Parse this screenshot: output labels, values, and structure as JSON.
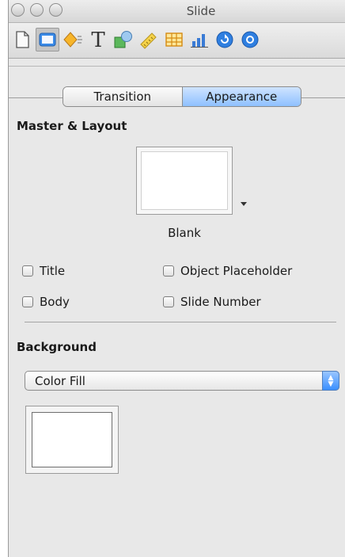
{
  "window": {
    "title": "Slide"
  },
  "toolbar": {
    "items": [
      {
        "name": "document-inspector",
        "icon": "document-icon"
      },
      {
        "name": "slide-inspector",
        "icon": "slide-icon",
        "selected": true
      },
      {
        "name": "slide-transition-inspector",
        "icon": "diamond-icon"
      },
      {
        "name": "text-inspector",
        "icon": "text-icon",
        "glyph": "T"
      },
      {
        "name": "graphic-inspector",
        "icon": "shapes-icon"
      },
      {
        "name": "metrics-inspector",
        "icon": "ruler-icon"
      },
      {
        "name": "table-inspector",
        "icon": "table-icon"
      },
      {
        "name": "chart-inspector",
        "icon": "chart-icon"
      },
      {
        "name": "hyperlink-inspector",
        "icon": "arrow-circle-icon"
      },
      {
        "name": "quicktime-inspector",
        "icon": "at-circle-icon"
      }
    ]
  },
  "tabs": {
    "transition": "Transition",
    "appearance": "Appearance",
    "active": "appearance"
  },
  "master_layout": {
    "heading": "Master & Layout",
    "thumbnail_label": "Blank",
    "checkboxes": {
      "title": "Title",
      "body": "Body",
      "object_placeholder": "Object Placeholder",
      "slide_number": "Slide Number"
    }
  },
  "background": {
    "heading": "Background",
    "fill_type": "Color Fill"
  },
  "colors": {
    "accent": "#3a8fff",
    "active_tab": "#8ec0ff",
    "panel": "#e8e8e8"
  }
}
